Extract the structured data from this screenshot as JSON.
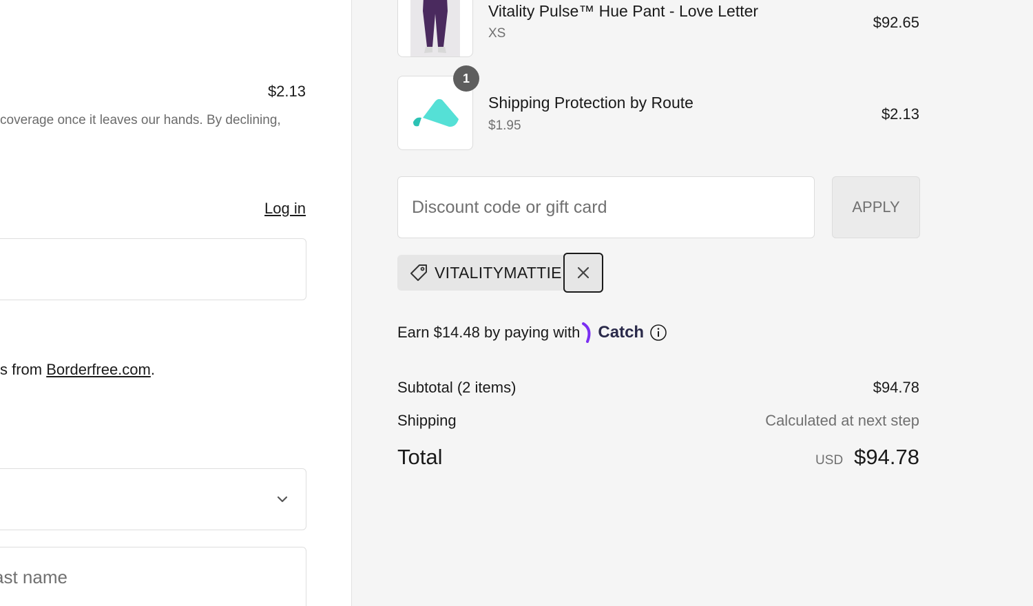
{
  "left": {
    "route_price": "$2.13",
    "route_description": "coverage once it leaves our hands. By declining,",
    "login_label": "Log in",
    "borderfree_prefix": "s from ",
    "borderfree_link": "Borderfree.com",
    "borderfree_suffix": ".",
    "last_name_placeholder": "ast name"
  },
  "cart": {
    "items": [
      {
        "name": "Vitality Pulse™ Hue Pant - Love Letter",
        "variant": "XS",
        "price": "$92.65",
        "image": "purple-leggings-photo"
      },
      {
        "name": "Shipping Protection by Route",
        "variant": "$1.95",
        "price": "$2.13",
        "quantity": "1",
        "image": "route-logo"
      }
    ]
  },
  "discount": {
    "placeholder": "Discount code or gift card",
    "apply_label": "APPLY",
    "applied_code": "VITALITYMATTIE"
  },
  "catch": {
    "text": "Earn $14.48 by paying with",
    "brand": "Catch"
  },
  "summary": {
    "subtotal_label": "Subtotal (2 items)",
    "subtotal_value": "$94.78",
    "shipping_label": "Shipping",
    "shipping_value": "Calculated at next step",
    "total_label": "Total",
    "currency": "USD",
    "total_value": "$94.78"
  },
  "colors": {
    "summary_bg": "#f5f5f5",
    "route_teal": "#3fd4c8",
    "catch_purple": "#7b2ff2"
  }
}
